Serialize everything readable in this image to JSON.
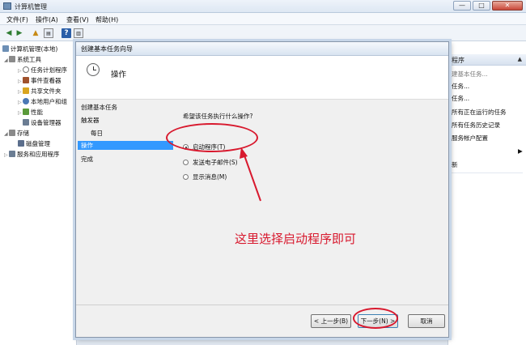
{
  "window": {
    "title": "计算机管理",
    "controls": {
      "minimize": "—",
      "maximize": "□",
      "close": "✕"
    }
  },
  "menu": [
    "文件(F)",
    "操作(A)",
    "查看(V)",
    "帮助(H)"
  ],
  "toolbar": {
    "back": "◀",
    "forward": "▶",
    "help": "?"
  },
  "tree": {
    "items": [
      {
        "label": "计算机管理(本地)",
        "color": "#6d8fb5"
      },
      {
        "label": "系统工具",
        "color": "#8a8a8a"
      },
      {
        "label": "任务计划程序",
        "color": "#7a7a7a"
      },
      {
        "label": "事件查看器",
        "color": "#a0522d"
      },
      {
        "label": "共享文件夹",
        "color": "#d9a520"
      },
      {
        "label": "本地用户和组",
        "color": "#4a78b5"
      },
      {
        "label": "性能",
        "color": "#5a9a3a"
      },
      {
        "label": "设备管理器",
        "color": "#6b7d93"
      },
      {
        "label": "存储",
        "color": "#8a8a8a"
      },
      {
        "label": "磁盘管理",
        "color": "#5b6e8c"
      },
      {
        "label": "服务和应用程序",
        "color": "#6b7d93"
      }
    ]
  },
  "actions": {
    "header": "程序",
    "items": [
      "建基本任务...",
      "任务...",
      "任务...",
      "所有正在运行的任务",
      "所有任务历史记录",
      "服务帐户配置",
      "",
      "",
      "新"
    ]
  },
  "wizard": {
    "title": "创建基本任务向导",
    "heading": "操作",
    "nav": {
      "items": [
        {
          "label": "创建基本任务",
          "indent": false,
          "selected": false
        },
        {
          "label": "触发器",
          "indent": false,
          "selected": false
        },
        {
          "label": "每日",
          "indent": true,
          "selected": false
        },
        {
          "label": "操作",
          "indent": false,
          "selected": true
        },
        {
          "label": "完成",
          "indent": false,
          "selected": false
        }
      ]
    },
    "question": "希望该任务执行什么操作?",
    "options": [
      {
        "label": "启动程序(T)",
        "checked": true
      },
      {
        "label": "发送电子邮件(S)",
        "checked": false
      },
      {
        "label": "显示消息(M)",
        "checked": false
      }
    ],
    "buttons": {
      "back": "< 上一步(B)",
      "next": "下一步(N) >",
      "cancel": "取消"
    }
  },
  "annotation": {
    "text": "这里选择启动程序即可",
    "color": "#d8192e"
  }
}
